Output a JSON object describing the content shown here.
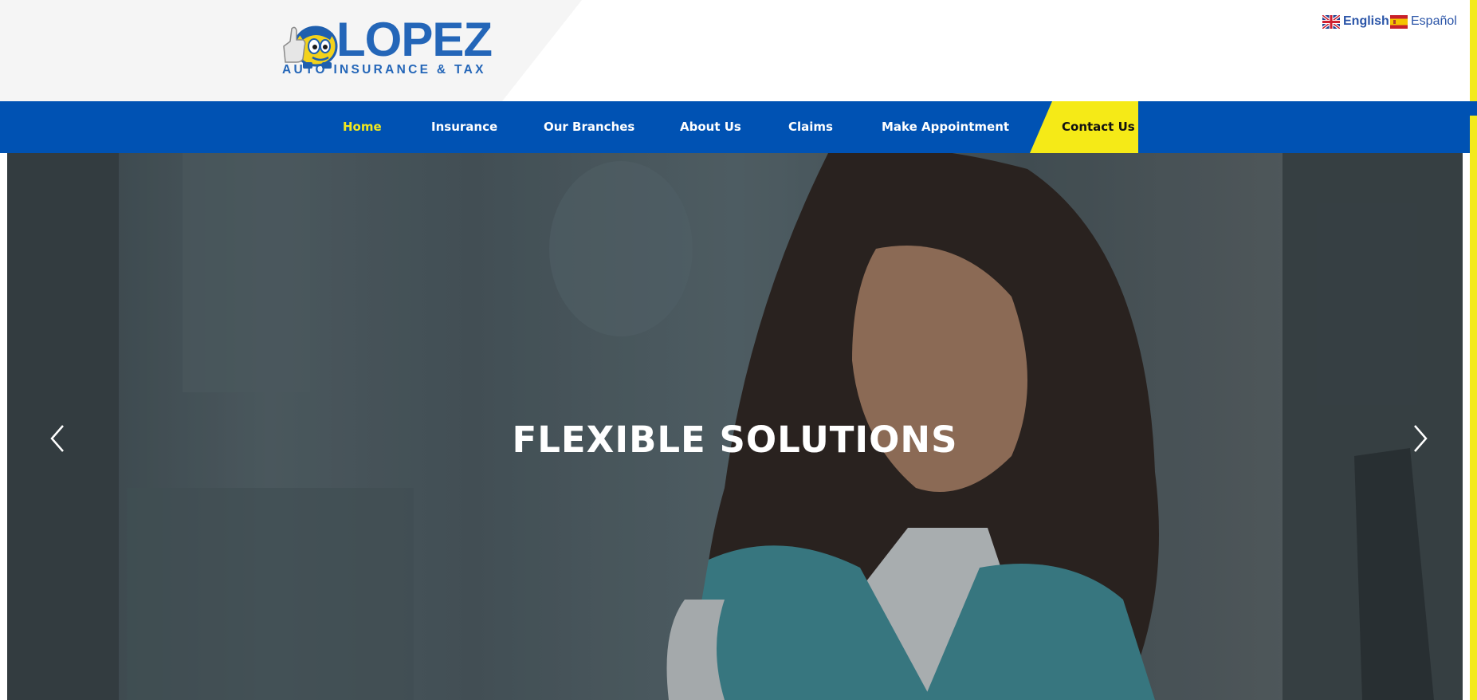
{
  "header": {
    "logo": {
      "word": "LOPEZ",
      "subtitle": "AUTO INSURANCE & TAX",
      "icon": "mascot-car-thumbs-up-icon"
    },
    "languages": [
      {
        "label": "English",
        "icon": "uk-flag-icon",
        "selected": true
      },
      {
        "label": "Español",
        "icon": "spain-flag-icon",
        "selected": false
      }
    ]
  },
  "nav": {
    "items": [
      {
        "label": "Home",
        "active": true
      },
      {
        "label": "Insurance",
        "active": false
      },
      {
        "label": "Our Branches",
        "active": false
      },
      {
        "label": "About Us",
        "active": false
      },
      {
        "label": "Claims",
        "active": false
      },
      {
        "label": "Make Appointment",
        "active": false
      }
    ],
    "contact_label": "Contact Us"
  },
  "hero": {
    "title": "FLEXIBLE SOLUTIONS",
    "prev_icon": "chevron-left-icon",
    "next_icon": "chevron-right-icon"
  },
  "colors": {
    "nav_bg": "#0052b3",
    "accent_yellow": "#f3ea1c",
    "brand_blue": "#2466b8",
    "active_link": "#f1e81f"
  }
}
